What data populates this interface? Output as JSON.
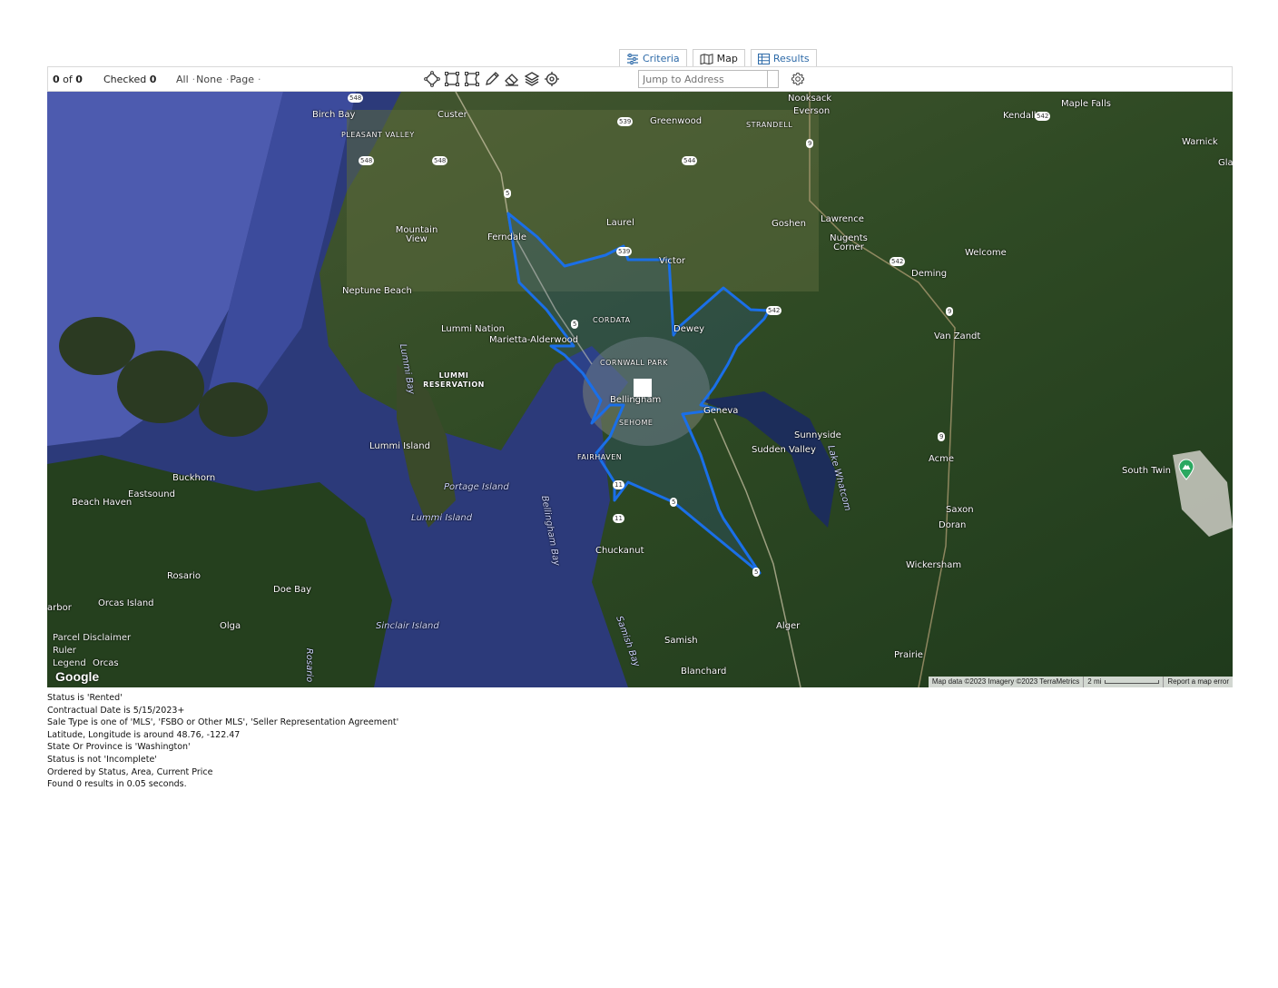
{
  "tabs": [
    {
      "label": "Criteria",
      "icon": "sliders-icon"
    },
    {
      "label": "Map",
      "icon": "map-icon"
    },
    {
      "label": "Results",
      "icon": "table-icon"
    }
  ],
  "toolbar": {
    "count_current": "0",
    "count_of": "of",
    "count_total": "0",
    "checked_label": "Checked",
    "checked_value": "0",
    "select_all": "All",
    "select_none": "None",
    "select_page": "Page",
    "jump_placeholder": "Jump to Address",
    "tools": [
      "polygon-icon",
      "rectangle-icon",
      "rectangle-edit-icon",
      "pencil-icon",
      "eraser-icon",
      "layers-icon",
      "locate-icon"
    ]
  },
  "map": {
    "labels": {
      "birch_bay": "Birch Bay",
      "custer": "Custer",
      "pleasant_valley": "PLEASANT VALLEY",
      "greenwood": "Greenwood",
      "strandell": "STRANDELL",
      "nooksack": "Nooksack",
      "everson": "Everson",
      "kendall": "Kendall",
      "maple_falls": "Maple Falls",
      "warnick": "Warnick",
      "gla": "Gla",
      "ferndale": "Ferndale",
      "laurel": "Laurel",
      "goshen": "Goshen",
      "lawrence": "Lawrence",
      "nugents_corner": "Nugents Corner",
      "welcome": "Welcome",
      "mountain_view": "Mountain View",
      "victor": "Victor",
      "deming": "Deming",
      "neptune_beach": "Neptune Beach",
      "cordata": "CORDATA",
      "dewey": "Dewey",
      "lummi_nation": "Lummi Nation",
      "marietta": "Marietta-Alderwood",
      "van_zandt": "Van Zandt",
      "cornwall_park": "CORNWALL PARK",
      "lummi_bay": "Lummi Bay",
      "lummi_reservation": "LUMMI RESERVATION",
      "bellingham": "Bellingham",
      "geneva": "Geneva",
      "sehome": "SEHOME",
      "sunnyside": "Sunnyside",
      "lummi_island": "Lummi Island",
      "sudden_valley": "Sudden Valley",
      "fairhaven": "FAIRHAVEN",
      "lake_whatcom": "Lake Whatcom",
      "acme": "Acme",
      "south_twin": "South Twin",
      "buckhorn": "Buckhorn",
      "eastsound": "Eastsound",
      "beach_haven": "Beach Haven",
      "portage_island": "Portage Island",
      "lummi_island_2": "Lummi Island",
      "bellingham_bay": "Bellingham Bay",
      "saxon": "Saxon",
      "doran": "Doran",
      "chuckanut": "Chuckanut",
      "rosario": "Rosario",
      "wickersham": "Wickersham",
      "doe_bay": "Doe Bay",
      "arbor": "arbor",
      "orcas_island": "Orcas Island",
      "olga": "Olga",
      "sinclair_island": "Sinclair Island",
      "alger": "Alger",
      "samish": "Samish",
      "samish_bay": "Samish Bay",
      "prairie": "Prairie",
      "orcas": "Orcas",
      "blanchard": "Blanchard",
      "rosario_2": "Rosario"
    },
    "shields": {
      "s548a": "548",
      "s539": "539",
      "s548b": "548",
      "s548c": "548",
      "s544": "544",
      "s9a": "9",
      "s5a": "5",
      "s539b": "539",
      "s542a": "542",
      "s542b": "542",
      "s9b": "9",
      "s542c": "542",
      "s5b": "5",
      "s9c": "9",
      "s11a": "11",
      "s11b": "11",
      "s5c": "5",
      "s5d": "5"
    },
    "links": {
      "parcel": "Parcel Disclaimer",
      "ruler": "Ruler",
      "legend": "Legend"
    },
    "google_logo": "Google",
    "attribution": "Map data ©2023 Imagery ©2023 TerraMetrics",
    "scale": "2 mi",
    "report": "Report a map error",
    "polygon_color": "#1a6fe8"
  },
  "summary": [
    "Status is 'Rented'",
    "Contractual Date is 5/15/2023+",
    "Sale Type is one of 'MLS', 'FSBO or Other MLS', 'Seller Representation Agreement'",
    "Latitude, Longitude is around 48.76, -122.47",
    "State Or Province is 'Washington'",
    "Status is not 'Incomplete'",
    "Ordered by Status, Area, Current Price",
    "Found 0 results in 0.05 seconds."
  ]
}
